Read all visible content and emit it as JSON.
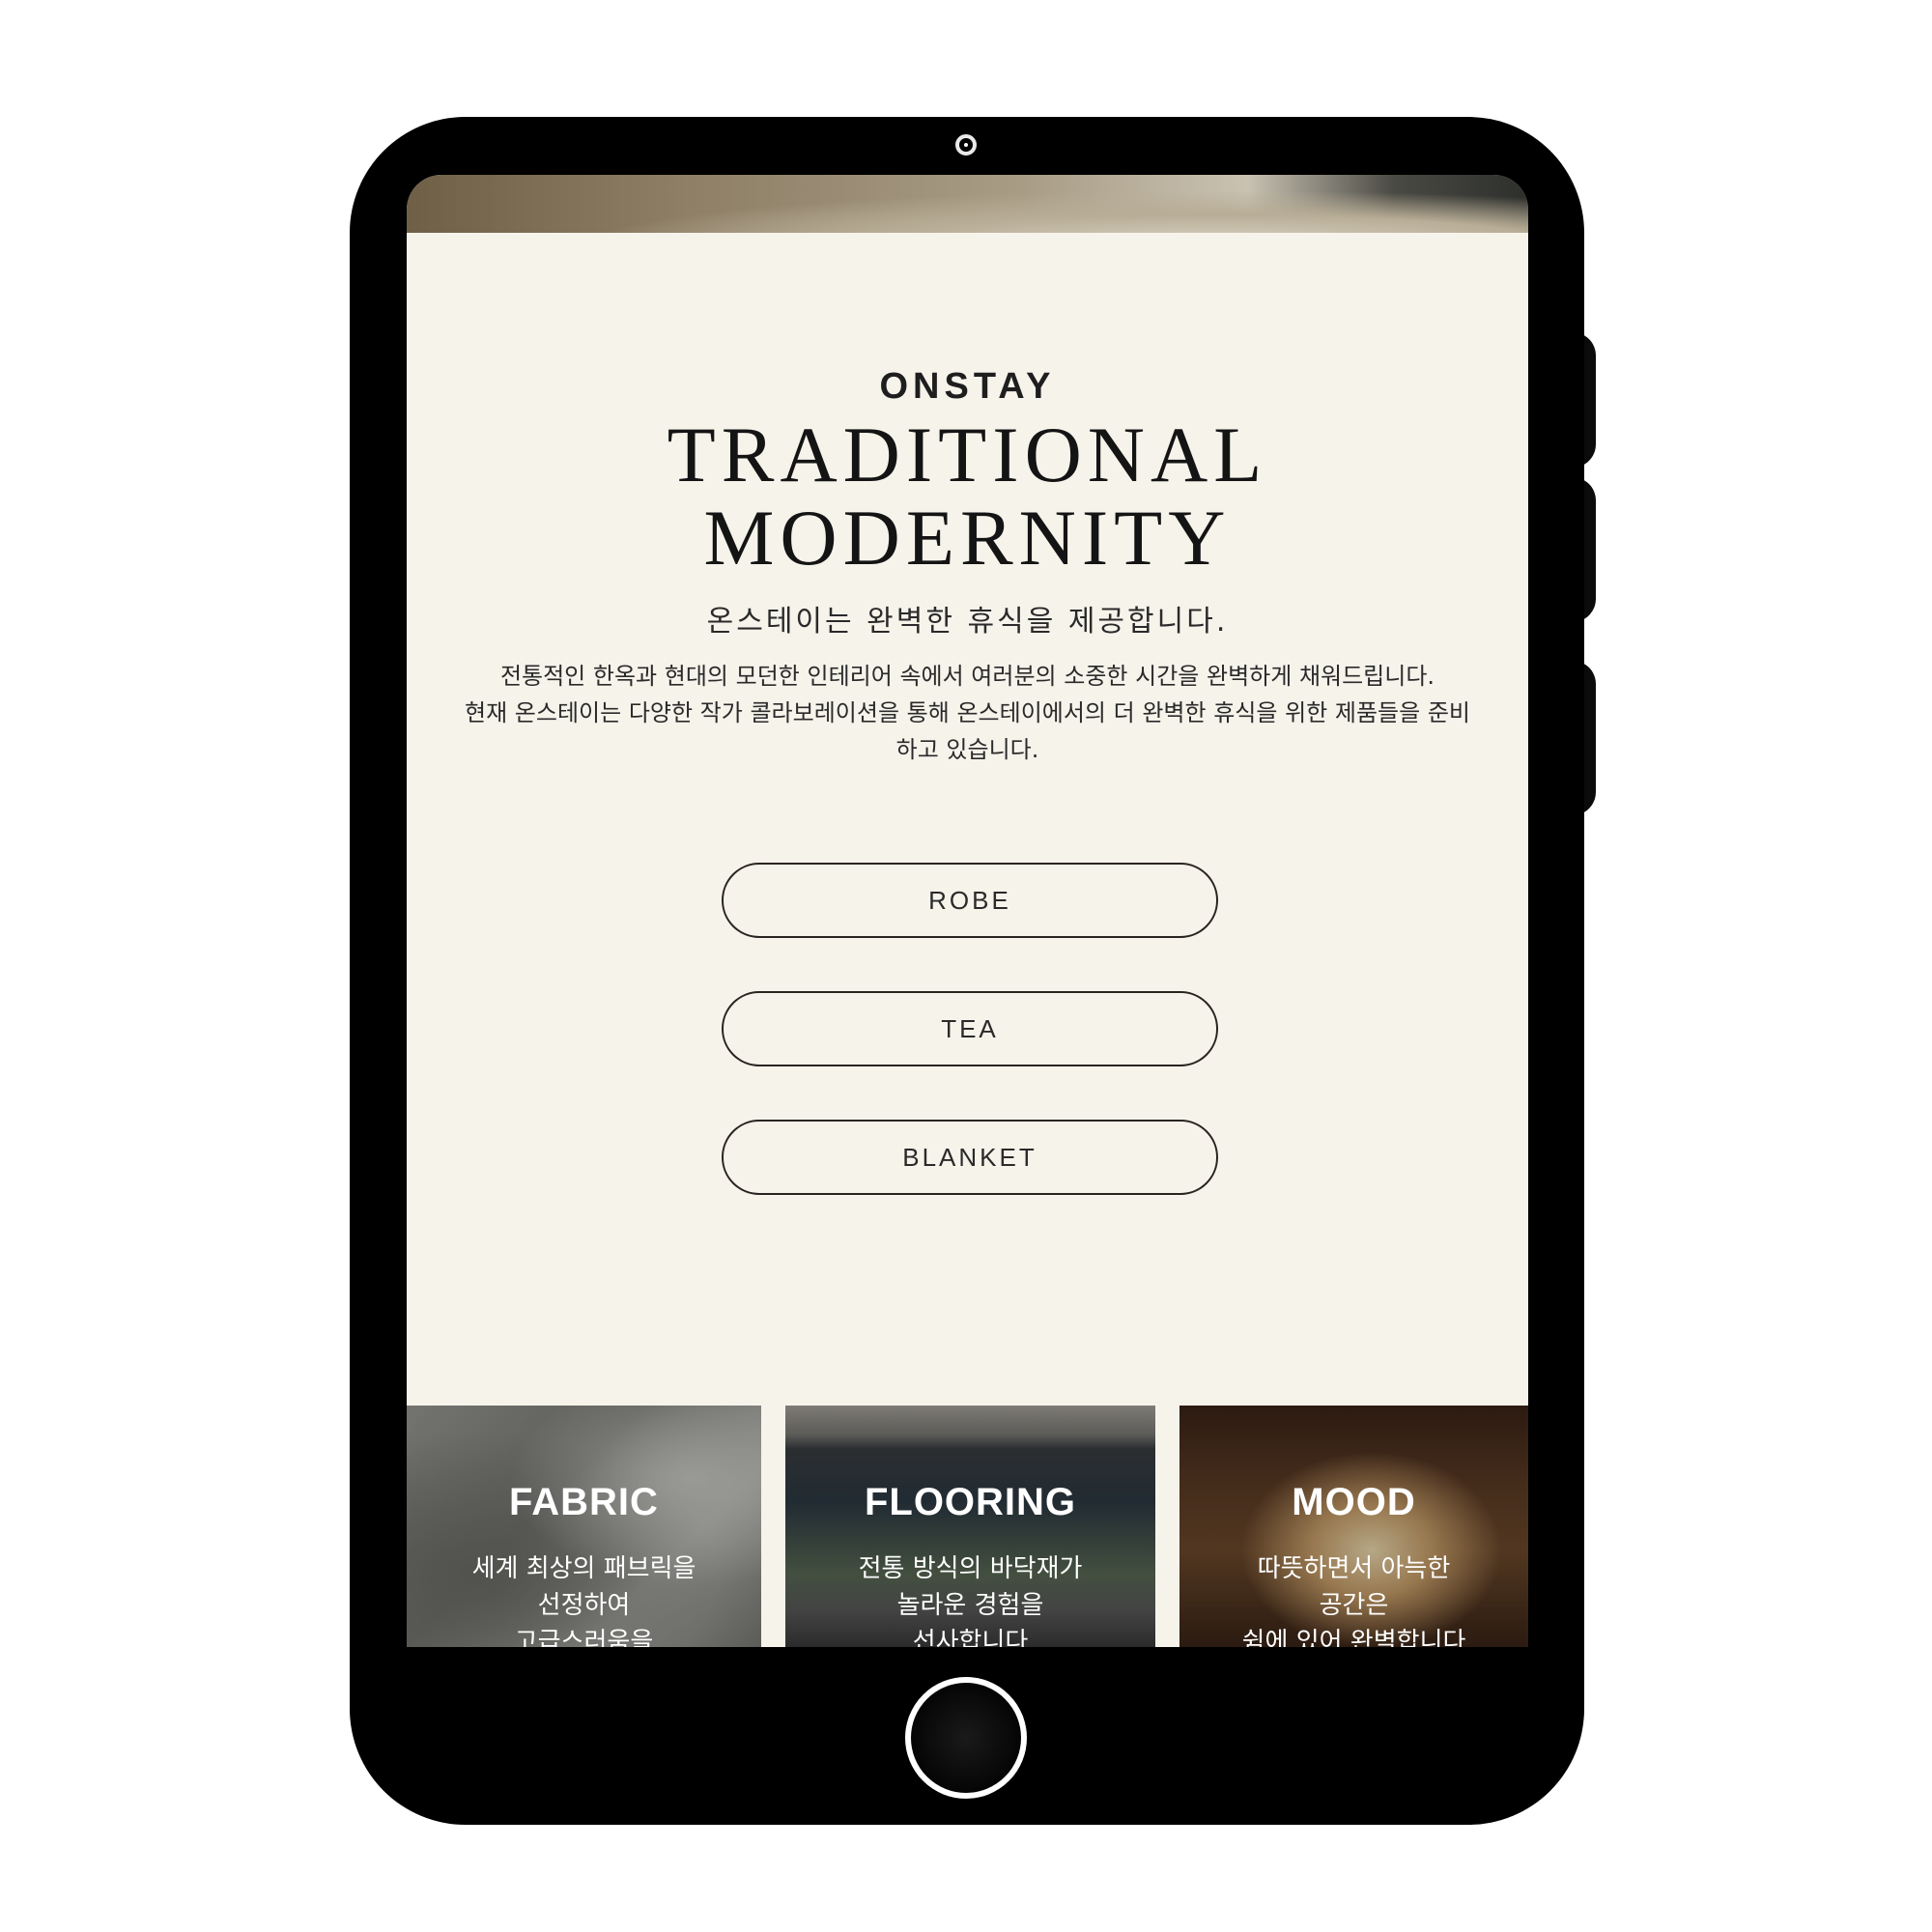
{
  "brand": "ONSTAY",
  "headline": {
    "line1": "TRADITIONAL",
    "line2": "MODERNITY"
  },
  "subheadline": "온스테이는 완벽한 휴식을 제공합니다.",
  "description": {
    "line1": "전통적인 한옥과 현대의 모던한 인테리어 속에서 여러분의 소중한 시간을 완벽하게 채워드립니다.",
    "line2": "현재 온스테이는 다양한 작가 콜라보레이션을 통해 온스테이에서의 더 완벽한 휴식을 위한 제품들을 준비하고 있습니다."
  },
  "buttons": {
    "robe": "ROBE",
    "tea": "TEA",
    "blanket": "BLANKET"
  },
  "cards": [
    {
      "title": "FABRIC",
      "text": "세계 최상의 패브릭을\n선정하여\n고급스러움을"
    },
    {
      "title": "FLOORING",
      "text": "전통 방식의 바닥재가\n놀라운 경험을\n선사합니다"
    },
    {
      "title": "MOOD",
      "text": "따뜻하면서 아늑한\n공간은\n쉼에 있어 완벽합니다"
    }
  ],
  "colors": {
    "background": "#f6f3eb",
    "device": "#000000",
    "text": "#1a1a1a",
    "pill_border": "#2a2420"
  }
}
